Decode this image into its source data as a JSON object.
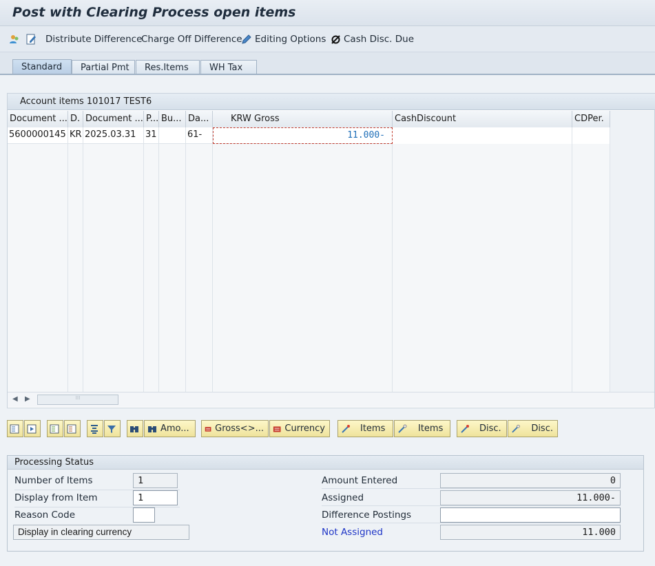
{
  "title": "Post with Clearing Process open items",
  "toolbar": {
    "distribute": "Distribute Difference",
    "charge_off": "Charge Off Difference",
    "editing": "Editing Options",
    "cash_disc": "Cash Disc. Due"
  },
  "tabs": [
    "Standard",
    "Partial Pmt",
    "Res.Items",
    "WH Tax"
  ],
  "grid": {
    "title": "Account items 101017 TEST6",
    "columns": [
      "Document ...",
      "D.",
      "Document ...",
      "P...",
      "Bu...",
      "Da...",
      "KRW Gross",
      "CashDiscount",
      "CDPer."
    ],
    "rows": [
      {
        "doc": "5600000145",
        "d": "KR",
        "date": "2025.03.31",
        "p": "31",
        "bu": "",
        "da": "61-",
        "gross": "11.000-",
        "cash": "",
        "cdper": ""
      }
    ]
  },
  "buttons": {
    "amount": "Amo...",
    "gross": "Gross<>...",
    "currency": "Currency",
    "items1": "Items",
    "items2": "Items",
    "disc1": "Disc.",
    "disc2": "Disc."
  },
  "status": {
    "heading": "Processing Status",
    "num_items_label": "Number of Items",
    "num_items": "1",
    "display_from_label": "Display from Item",
    "display_from": "1",
    "reason_label": "Reason Code",
    "reason": "",
    "display_clearing": "Display in clearing currency",
    "amount_entered_label": "Amount Entered",
    "amount_entered": "0",
    "assigned_label": "Assigned",
    "assigned": "11.000-",
    "diff_label": "Difference Postings",
    "diff": "",
    "not_assigned_label": "Not Assigned",
    "not_assigned": "11.000"
  },
  "colors": {
    "accent_blue": "#1d34c6",
    "link_blue": "#1f6fb8",
    "button_yellow": "#f5eba8"
  }
}
